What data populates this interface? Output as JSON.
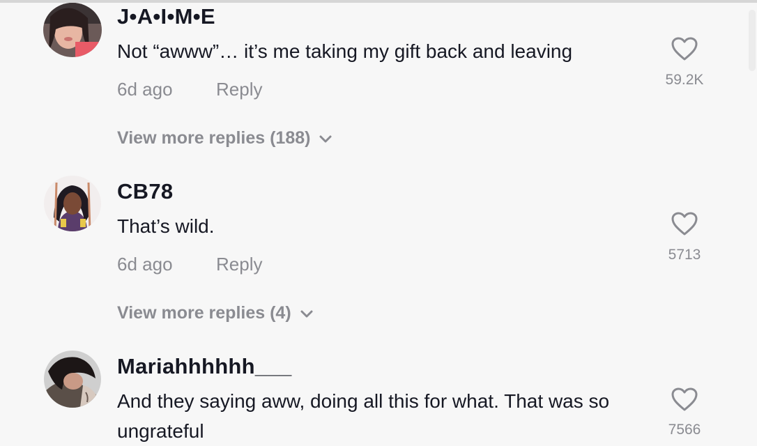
{
  "comments": [
    {
      "username": "J•A•I•M•E",
      "text": "Not “awww”… it’s me taking my gift back and leaving",
      "time": "6d ago",
      "reply_label": "Reply",
      "likes": "59.2K",
      "more_replies": "View more replies (188)",
      "like_icon": "heart-outline-icon",
      "chevron_icon": "chevron-down-icon"
    },
    {
      "username": "CB78",
      "text": "That’s wild.",
      "time": "6d ago",
      "reply_label": "Reply",
      "likes": "5713",
      "more_replies": "View more replies (4)",
      "like_icon": "heart-outline-icon",
      "chevron_icon": "chevron-down-icon"
    },
    {
      "username": "Mariahhhhhh___",
      "text": "And they saying aww, doing all this for what. That was so ungrateful",
      "likes": "7566",
      "like_icon": "heart-outline-icon"
    }
  ],
  "colors": {
    "background": "#f7f7f7",
    "primary_text": "#161823",
    "secondary_text": "#8a8b91"
  }
}
